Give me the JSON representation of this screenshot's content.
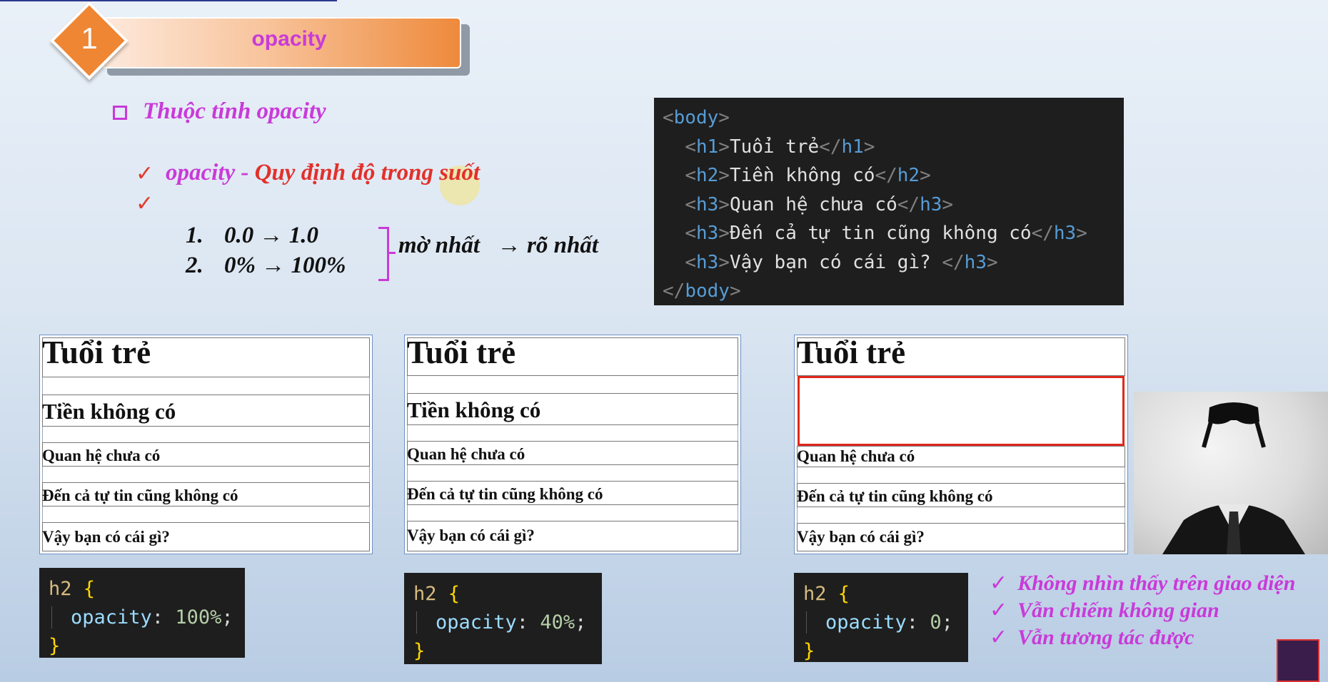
{
  "slide": {
    "number": "1",
    "title": "opacity",
    "heading": "Thuộc tính opacity",
    "definition_prop": "opacity - ",
    "definition_text": "Quy định độ trong suốt",
    "range1_idx": "1.",
    "range1": "0.0 → 1.0",
    "range2_idx": "2.",
    "range2": "0% → 100%",
    "range_from": "mờ nhất",
    "range_to": "→ rõ nhất"
  },
  "code_body": {
    "open_body": "body",
    "h1_tag": "h1",
    "h1_text": "Tuổi trẻ",
    "h2_tag": "h2",
    "h2_text": "Tiền không có",
    "h3_tag": "h3",
    "h3a_text": "Quan hệ chưa có",
    "h3b_text": "Đến cả tự tin cũng không có",
    "h3c_text": "Vậy bạn có cái gì? ",
    "close_body": "body"
  },
  "demo_text": {
    "h1": "Tuổi trẻ",
    "h2": "Tiền không có",
    "h3a": "Quan hệ chưa có",
    "h3b": "Đến cả tự tin cũng không có",
    "h3c": "Vậy bạn có cái gì?"
  },
  "css_examples": [
    {
      "selector": "h2",
      "property": "opacity",
      "value": "100%"
    },
    {
      "selector": "h2",
      "property": "opacity",
      "value": "40%"
    },
    {
      "selector": "h2",
      "property": "opacity",
      "value": "0"
    }
  ],
  "notes": [
    "Không nhìn thấy trên giao diện",
    "Vẫn chiếm không gian",
    "Vẫn tương tác được"
  ],
  "colors": {
    "accent_pink": "#c93ad9",
    "accent_red": "#e2302a",
    "banner_orange": "#ee8633",
    "code_bg": "#1e1e1e"
  },
  "icons": {
    "bullet": "square-bullet-icon",
    "check": "check-icon",
    "badge": "number-diamond-icon"
  }
}
